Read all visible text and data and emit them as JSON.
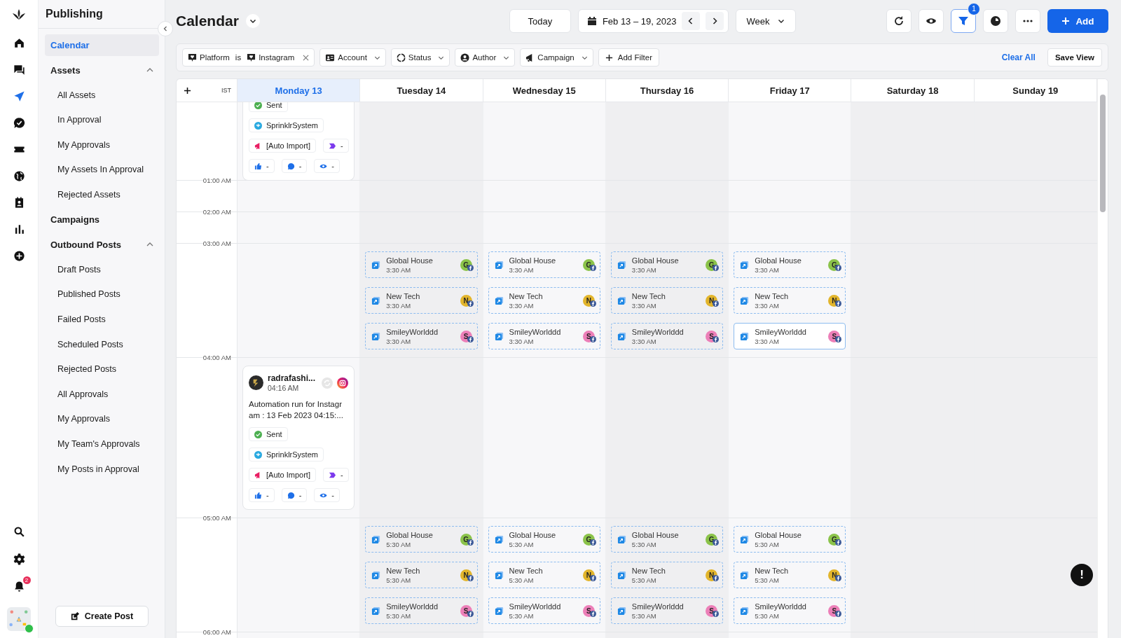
{
  "rail": {
    "items": [
      {
        "kind": "home",
        "selected": false
      },
      {
        "kind": "chat",
        "selected": false
      },
      {
        "kind": "send",
        "selected": true
      },
      {
        "kind": "check",
        "selected": false
      },
      {
        "kind": "ticket",
        "selected": false
      },
      {
        "kind": "globe",
        "selected": false
      },
      {
        "kind": "contact",
        "selected": false
      },
      {
        "kind": "chart",
        "selected": false
      },
      {
        "kind": "plus",
        "selected": false
      }
    ],
    "bottom": [
      {
        "kind": "search"
      },
      {
        "kind": "settings"
      },
      {
        "kind": "bell",
        "badge": "2"
      }
    ]
  },
  "sidebar": {
    "title": "Publishing",
    "items": [
      {
        "label": "Calendar",
        "selected": true
      },
      {
        "label": "Assets",
        "selected": false,
        "expanded": true,
        "children": [
          {
            "label": "All Assets",
            "selected": false
          },
          {
            "label": "In Approval",
            "selected": false
          },
          {
            "label": "My Approvals",
            "selected": false
          },
          {
            "label": "My Assets In Approval",
            "selected": false
          },
          {
            "label": "Rejected Assets",
            "selected": false
          }
        ]
      },
      {
        "label": "Campaigns",
        "selected": false
      },
      {
        "label": "Outbound Posts",
        "selected": false,
        "expanded": true,
        "children": [
          {
            "label": "Draft Posts",
            "selected": false
          },
          {
            "label": "Published Posts",
            "selected": false
          },
          {
            "label": "Failed Posts",
            "selected": false
          },
          {
            "label": "Scheduled Posts",
            "selected": false
          },
          {
            "label": "Rejected Posts",
            "selected": false
          },
          {
            "label": "All Approvals",
            "selected": false
          },
          {
            "label": "My Approvals",
            "selected": false
          },
          {
            "label": "My Team's Approvals",
            "selected": false
          },
          {
            "label": "My Posts in Approval",
            "selected": false
          }
        ]
      }
    ],
    "create_button": "Create Post"
  },
  "header": {
    "title": "Calendar",
    "today": "Today",
    "date_range": "Feb 13 – 19, 2023",
    "view": "Week",
    "filter_badge": "1",
    "add": "Add"
  },
  "filters": [
    {
      "kind": "platform",
      "label": "Platform",
      "operator": "is",
      "value": "Instagram"
    },
    {
      "kind": "account",
      "label": "Account"
    },
    {
      "kind": "status",
      "label": "Status"
    },
    {
      "kind": "author",
      "label": "Author"
    },
    {
      "kind": "campaign",
      "label": "Campaign"
    }
  ],
  "add_filter": "Add Filter",
  "clear_all": "Clear All",
  "save_view": "Save View",
  "calendar": {
    "timezone": "IST",
    "days": [
      {
        "label": "Monday 13",
        "selected": true
      },
      {
        "label": "Tuesday 14",
        "selected": false
      },
      {
        "label": "Wednesday 15",
        "selected": false
      },
      {
        "label": "Thursday 16",
        "selected": false
      },
      {
        "label": "Friday 17",
        "selected": false
      },
      {
        "label": "Saturday 18",
        "selected": false
      },
      {
        "label": "Sunday 19",
        "selected": false
      }
    ],
    "rows": [
      {
        "cells": [
          [
            {
              "kind": "post_tail",
              "status": "Sent",
              "user": "SprinklrSystem",
              "campaign": "[Auto Import]",
              "tag": "-",
              "likes": "-",
              "comments": "-",
              "views": "-"
            }
          ],
          [],
          [],
          [],
          [],
          [],
          []
        ]
      },
      {
        "time": "01:00 AM",
        "cells": [
          [],
          [],
          [],
          [],
          [],
          [],
          []
        ]
      },
      {
        "time": "02:00 AM",
        "cells": [
          [],
          [],
          [],
          [],
          [],
          [],
          []
        ]
      },
      {
        "time": "03:00 AM",
        "cells": [
          [],
          [
            {
              "kind": "event",
              "name": "Global House",
              "time": "3:30 AM",
              "initial": "G",
              "color": "#8bc34a",
              "selected": false
            },
            {
              "kind": "event",
              "name": "New Tech",
              "time": "3:30 AM",
              "initial": "N",
              "color": "#e2b52c",
              "selected": false
            },
            {
              "kind": "event",
              "name": "SmileyWorlddd",
              "time": "3:30 AM",
              "initial": "S",
              "color": "#ec7fb8",
              "selected": false
            }
          ],
          [
            {
              "kind": "event",
              "name": "Global House",
              "time": "3:30 AM",
              "initial": "G",
              "color": "#8bc34a",
              "selected": false
            },
            {
              "kind": "event",
              "name": "New Tech",
              "time": "3:30 AM",
              "initial": "N",
              "color": "#e2b52c",
              "selected": false
            },
            {
              "kind": "event",
              "name": "SmileyWorlddd",
              "time": "3:30 AM",
              "initial": "S",
              "color": "#ec7fb8",
              "selected": false
            }
          ],
          [
            {
              "kind": "event",
              "name": "Global House",
              "time": "3:30 AM",
              "initial": "G",
              "color": "#8bc34a",
              "selected": false
            },
            {
              "kind": "event",
              "name": "New Tech",
              "time": "3:30 AM",
              "initial": "N",
              "color": "#e2b52c",
              "selected": false
            },
            {
              "kind": "event",
              "name": "SmileyWorlddd",
              "time": "3:30 AM",
              "initial": "S",
              "color": "#ec7fb8",
              "selected": false
            }
          ],
          [
            {
              "kind": "event",
              "name": "Global House",
              "time": "3:30 AM",
              "initial": "G",
              "color": "#8bc34a",
              "selected": false
            },
            {
              "kind": "event",
              "name": "New Tech",
              "time": "3:30 AM",
              "initial": "N",
              "color": "#e2b52c",
              "selected": false
            },
            {
              "kind": "event",
              "name": "SmileyWorlddd",
              "time": "3:30 AM",
              "initial": "S",
              "color": "#ec7fb8",
              "selected": true
            }
          ],
          [],
          []
        ]
      },
      {
        "time": "04:00 AM",
        "cells": [
          [
            {
              "kind": "post",
              "author": "radrafashi...",
              "time": "04:16 AM",
              "text": "Automation run for Instagram : 13 Feb 2023 04:15:...",
              "status": "Sent",
              "user": "SprinklrSystem",
              "campaign": "[Auto Import]",
              "tag": "-",
              "likes": "-",
              "comments": "-",
              "views": "-"
            }
          ],
          [],
          [],
          [],
          [],
          [],
          []
        ]
      },
      {
        "time": "05:00 AM",
        "cells": [
          [],
          [
            {
              "kind": "event",
              "name": "Global House",
              "time": "5:30 AM",
              "initial": "G",
              "color": "#8bc34a",
              "selected": false
            },
            {
              "kind": "event",
              "name": "New Tech",
              "time": "5:30 AM",
              "initial": "N",
              "color": "#e2b52c",
              "selected": false
            },
            {
              "kind": "event",
              "name": "SmileyWorlddd",
              "time": "5:30 AM",
              "initial": "S",
              "color": "#ec7fb8",
              "selected": false
            }
          ],
          [
            {
              "kind": "event",
              "name": "Global House",
              "time": "5:30 AM",
              "initial": "G",
              "color": "#8bc34a",
              "selected": false
            },
            {
              "kind": "event",
              "name": "New Tech",
              "time": "5:30 AM",
              "initial": "N",
              "color": "#e2b52c",
              "selected": false
            },
            {
              "kind": "event",
              "name": "SmileyWorlddd",
              "time": "5:30 AM",
              "initial": "S",
              "color": "#ec7fb8",
              "selected": false
            }
          ],
          [
            {
              "kind": "event",
              "name": "Global House",
              "time": "5:30 AM",
              "initial": "G",
              "color": "#8bc34a",
              "selected": false
            },
            {
              "kind": "event",
              "name": "New Tech",
              "time": "5:30 AM",
              "initial": "N",
              "color": "#e2b52c",
              "selected": false
            },
            {
              "kind": "event",
              "name": "SmileyWorlddd",
              "time": "5:30 AM",
              "initial": "S",
              "color": "#ec7fb8",
              "selected": false
            }
          ],
          [
            {
              "kind": "event",
              "name": "Global House",
              "time": "5:30 AM",
              "initial": "G",
              "color": "#8bc34a",
              "selected": false
            },
            {
              "kind": "event",
              "name": "New Tech",
              "time": "5:30 AM",
              "initial": "N",
              "color": "#e2b52c",
              "selected": false
            },
            {
              "kind": "event",
              "name": "SmileyWorlddd",
              "time": "5:30 AM",
              "initial": "S",
              "color": "#ec7fb8",
              "selected": false
            }
          ],
          [],
          []
        ]
      },
      {
        "time": "06:00 AM",
        "cells": [
          [],
          [],
          [],
          [],
          [],
          [],
          []
        ]
      }
    ]
  },
  "help_button": "!"
}
